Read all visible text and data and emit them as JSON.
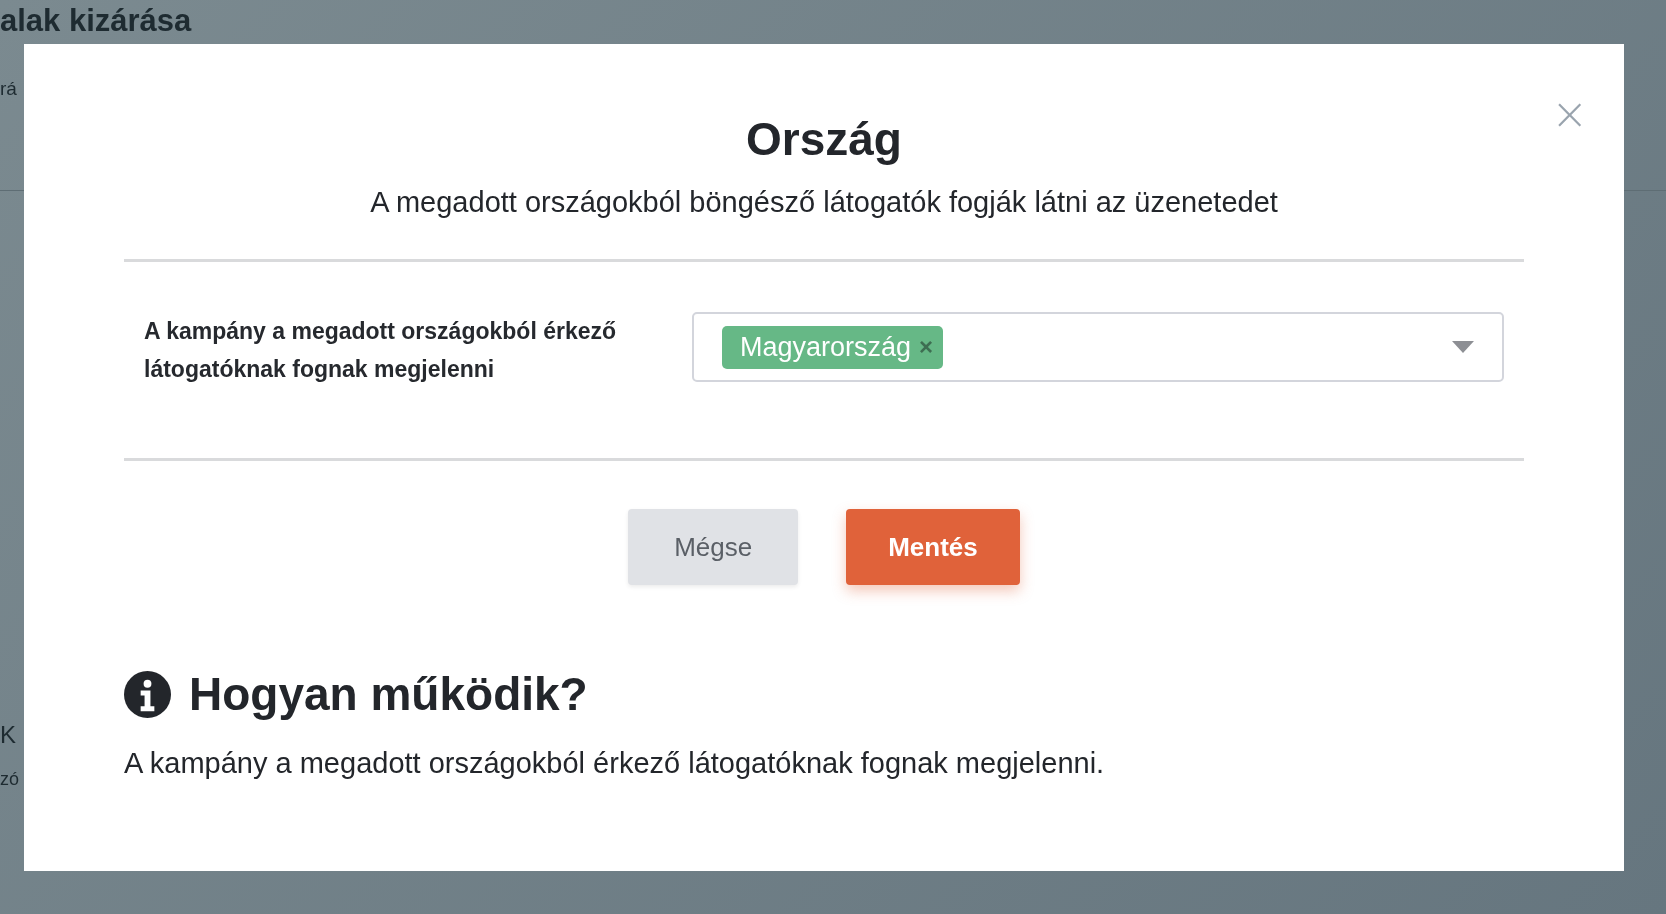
{
  "background": {
    "heading": "alak kizárása",
    "subtitle": "rá",
    "section_heading": "K",
    "section_text": "zó"
  },
  "modal": {
    "close_icon": "×",
    "title": "Ország",
    "subtitle": "A megadott országokból böngésző látogatók fogják látni az üzenetedet",
    "field": {
      "label": "A kampány a megadott országokból érkező látogatóknak fognak megjelenni",
      "tags": [
        {
          "label": "Magyarország",
          "remove": "×"
        }
      ]
    },
    "buttons": [
      {
        "label": "Mégse",
        "kind": "secondary"
      },
      {
        "label": "Mentés",
        "kind": "primary"
      }
    ],
    "info": {
      "heading": "Hogyan működik?",
      "text": "A kampány a megadott országokból érkező látogatóknak fognak megjelenni."
    }
  }
}
